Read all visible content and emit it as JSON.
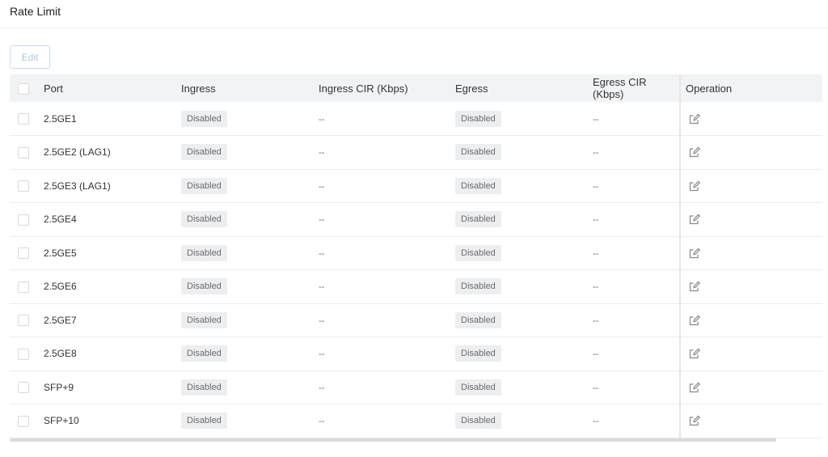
{
  "page": {
    "title": "Rate Limit"
  },
  "toolbar": {
    "edit_label": "Edit"
  },
  "table": {
    "columns": [
      "Port",
      "Ingress",
      "Ingress CIR (Kbps)",
      "Egress",
      "Egress CIR (Kbps)",
      "Operation"
    ],
    "rows": [
      {
        "port": "2.5GE1",
        "ingress": "Disabled",
        "ingress_cir": "--",
        "egress": "Disabled",
        "egress_cir": "--"
      },
      {
        "port": "2.5GE2 (LAG1)",
        "ingress": "Disabled",
        "ingress_cir": "--",
        "egress": "Disabled",
        "egress_cir": "--"
      },
      {
        "port": "2.5GE3 (LAG1)",
        "ingress": "Disabled",
        "ingress_cir": "--",
        "egress": "Disabled",
        "egress_cir": "--"
      },
      {
        "port": "2.5GE4",
        "ingress": "Disabled",
        "ingress_cir": "--",
        "egress": "Disabled",
        "egress_cir": "--"
      },
      {
        "port": "2.5GE5",
        "ingress": "Disabled",
        "ingress_cir": "--",
        "egress": "Disabled",
        "egress_cir": "--"
      },
      {
        "port": "2.5GE6",
        "ingress": "Disabled",
        "ingress_cir": "--",
        "egress": "Disabled",
        "egress_cir": "--"
      },
      {
        "port": "2.5GE7",
        "ingress": "Disabled",
        "ingress_cir": "--",
        "egress": "Disabled",
        "egress_cir": "--"
      },
      {
        "port": "2.5GE8",
        "ingress": "Disabled",
        "ingress_cir": "--",
        "egress": "Disabled",
        "egress_cir": "--"
      },
      {
        "port": "SFP+9",
        "ingress": "Disabled",
        "ingress_cir": "--",
        "egress": "Disabled",
        "egress_cir": "--"
      },
      {
        "port": "SFP+10",
        "ingress": "Disabled",
        "ingress_cir": "--",
        "egress": "Disabled",
        "egress_cir": "--"
      }
    ]
  },
  "icons": {
    "row_action": "edit-icon"
  },
  "colors": {
    "badge_bg": "#edeef0",
    "header_bg": "#f2f3f5",
    "edit_border": "#c8dcef"
  }
}
